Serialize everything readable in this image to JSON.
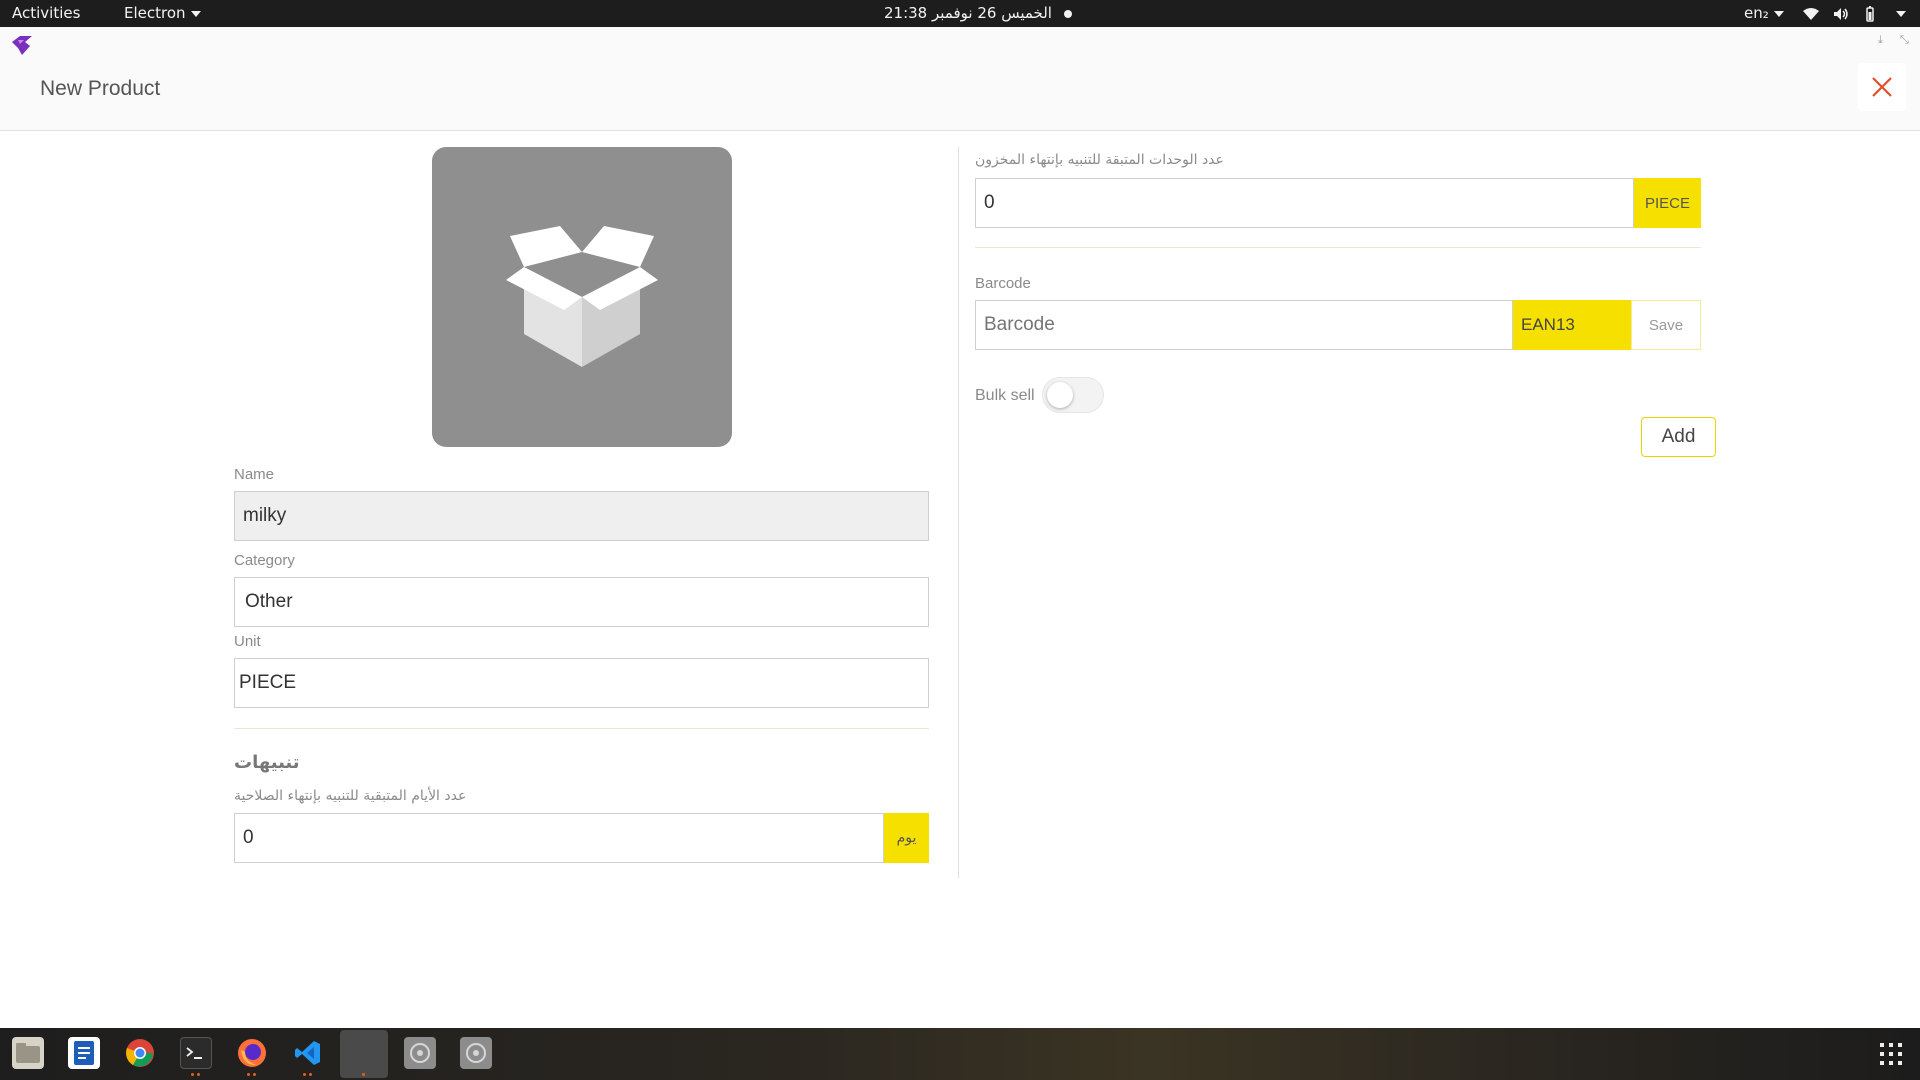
{
  "topbar": {
    "activities": "Activities",
    "app_menu": "Electron",
    "clock": "21:38  الخميس 26 نوفمبر",
    "language": "en₂"
  },
  "header": {
    "title": "New Product"
  },
  "product_image": {
    "icon": "open-box-icon"
  },
  "form_left": {
    "name_label": "Name",
    "name_value": "milky",
    "category_label": "Category",
    "category_value": "Other",
    "unit_label": "Unit",
    "unit_value": "PIECE",
    "alerts_title": "تنبيهات",
    "expiry_label": "عدد الأيام المتبقية للتنبيه بإنتهاء الصلاحية",
    "expiry_value": "0",
    "expiry_unit": "يوم"
  },
  "form_right": {
    "stock_label": "عدد الوحدات المتبقة للتنبيه بإنتهاء المخزون",
    "stock_value": "0",
    "stock_unit": "PIECE",
    "barcode_label": "Barcode",
    "barcode_placeholder": "Barcode",
    "barcode_type": "EAN13",
    "save_label": "Save",
    "bulk_sell_label": "Bulk sell",
    "bulk_sell_on": false,
    "add_label": "Add"
  },
  "colors": {
    "accent_yellow": "#f5e000",
    "close_red": "#e0502a",
    "app_icon_purple": "#7b2fbf"
  },
  "taskbar": {
    "apps": [
      "files-icon",
      "text-editor-icon",
      "chrome-icon",
      "terminal-icon",
      "firefox-icon",
      "vscode-icon",
      "electron-app-icon",
      "disk-icon",
      "disk-icon"
    ],
    "show_apps": "app-grid-icon"
  }
}
